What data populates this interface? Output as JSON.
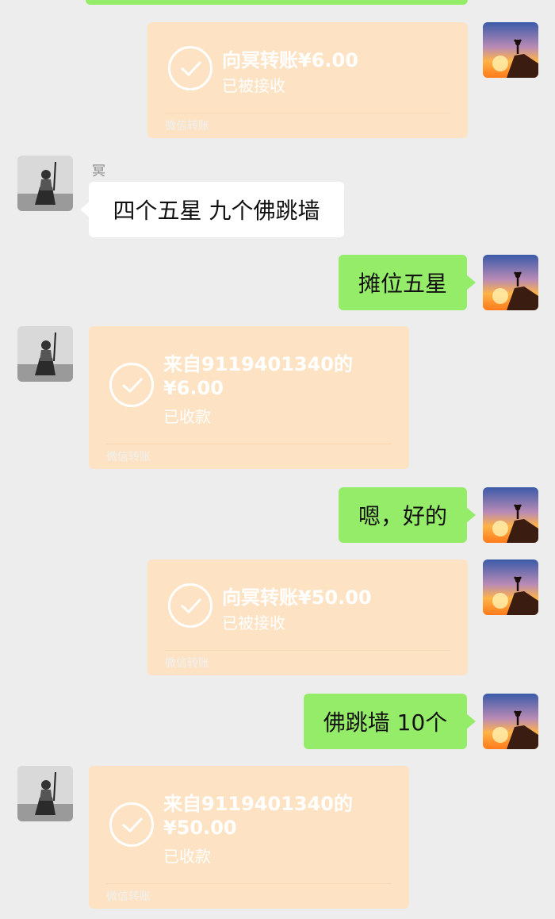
{
  "colors": {
    "background": "#ededed",
    "sent_bubble": "#95ec69",
    "received_bubble": "#ffffff",
    "transfer_card": "#fde3c4"
  },
  "messages": [
    {
      "type": "transfer",
      "side": "sent",
      "title": "向冥转账¥6.00",
      "status": "已被接收",
      "footer": "微信转账"
    },
    {
      "type": "text",
      "side": "received",
      "sender": "冥",
      "text": "四个五星 九个佛跳墙"
    },
    {
      "type": "text",
      "side": "sent",
      "text": "摊位五星"
    },
    {
      "type": "transfer",
      "side": "received",
      "title_line1": "来自9119401340的",
      "title_line2": "¥6.00",
      "status": "已收款",
      "footer": "微信转账"
    },
    {
      "type": "text",
      "side": "sent",
      "text": "嗯，好的"
    },
    {
      "type": "transfer",
      "side": "sent",
      "title": "向冥转账¥50.00",
      "status": "已被接收",
      "footer": "微信转账"
    },
    {
      "type": "text",
      "side": "sent",
      "text": "佛跳墙 10个"
    },
    {
      "type": "transfer",
      "side": "received",
      "title_line1": "来自9119401340的",
      "title_line2": "¥50.00",
      "status": "已收款",
      "footer": "微信转账"
    }
  ]
}
